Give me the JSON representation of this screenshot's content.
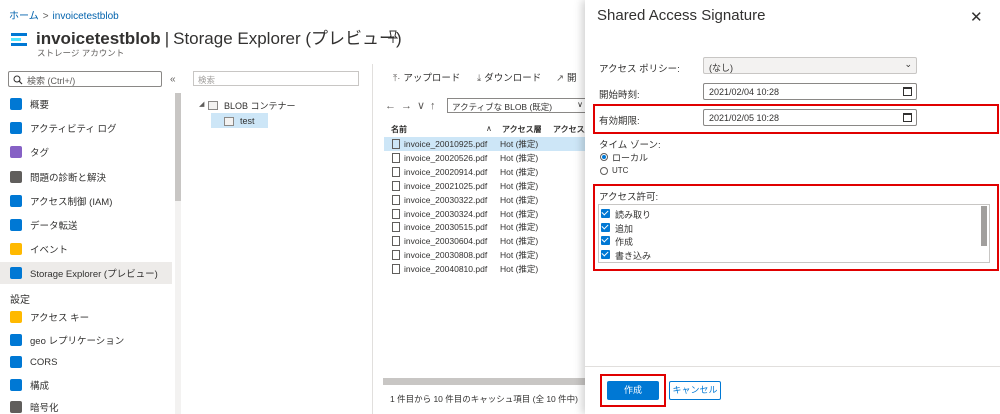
{
  "breadcrumb": {
    "home": "ホーム",
    "separator": ">",
    "current": "invoicetestblob"
  },
  "resource": {
    "name": "invoicetestblob",
    "section": "Storage Explorer (プレビュー)",
    "subtitle": "ストレージ アカウント"
  },
  "nav": {
    "search_placeholder": "検索 (Ctrl+/)",
    "collapse_glyph": "«",
    "items": [
      {
        "label": "概要",
        "icon": "overview-icon",
        "color": "#0078d4"
      },
      {
        "label": "アクティビティ ログ",
        "icon": "activity-log-icon",
        "color": "#0078d4"
      },
      {
        "label": "タグ",
        "icon": "tag-icon",
        "color": "#8661c5"
      },
      {
        "label": "問題の診断と解決",
        "icon": "wrench-icon",
        "color": "#605e5c"
      },
      {
        "label": "アクセス制御 (IAM)",
        "icon": "iam-icon",
        "color": "#0078d4"
      },
      {
        "label": "データ転送",
        "icon": "data-transfer-icon",
        "color": "#0078d4"
      },
      {
        "label": "イベント",
        "icon": "lightning-icon",
        "color": "#ffb900"
      },
      {
        "label": "Storage Explorer (プレビュー)",
        "icon": "storage-explorer-icon",
        "color": "#0078d4"
      }
    ],
    "settings_header": "設定",
    "settings_items": [
      {
        "label": "アクセス キー",
        "icon": "key-icon",
        "color": "#ffb900"
      },
      {
        "label": "geo レプリケーション",
        "icon": "globe-icon",
        "color": "#0078d4"
      },
      {
        "label": "CORS",
        "icon": "cors-icon",
        "color": "#0078d4"
      },
      {
        "label": "構成",
        "icon": "config-icon",
        "color": "#0078d4"
      },
      {
        "label": "暗号化",
        "icon": "lock-icon",
        "color": "#605e5c"
      }
    ]
  },
  "explorer": {
    "search_placeholder": "検索",
    "tree": {
      "root": "BLOB コンテナー",
      "child": "test"
    },
    "toolbar": {
      "upload": "アップロード",
      "download": "ダウンロード",
      "open": "開"
    },
    "nav_arrows": "←→∨↑",
    "path_value": "アクティブな BLOB (既定)",
    "columns": {
      "name": "名前",
      "access_tier": "アクセス層",
      "access_tier2": "アクセス層"
    },
    "files": [
      {
        "name": "invoice_20010925.pdf",
        "tier": "Hot (推定)"
      },
      {
        "name": "invoice_20020526.pdf",
        "tier": "Hot (推定)"
      },
      {
        "name": "invoice_20020914.pdf",
        "tier": "Hot (推定)"
      },
      {
        "name": "invoice_20021025.pdf",
        "tier": "Hot (推定)"
      },
      {
        "name": "invoice_20030322.pdf",
        "tier": "Hot (推定)"
      },
      {
        "name": "invoice_20030324.pdf",
        "tier": "Hot (推定)"
      },
      {
        "name": "invoice_20030515.pdf",
        "tier": "Hot (推定)"
      },
      {
        "name": "invoice_20030604.pdf",
        "tier": "Hot (推定)"
      },
      {
        "name": "invoice_20030808.pdf",
        "tier": "Hot (推定)"
      },
      {
        "name": "invoice_20040810.pdf",
        "tier": "Hot (推定)"
      }
    ],
    "status": "1 件目から 10 件目のキャッシュ項目 (全 10 件中)"
  },
  "sas": {
    "title": "Shared Access Signature",
    "close_glyph": "✕",
    "policy_label": "アクセス ポリシー:",
    "policy_value": "(なし)",
    "start_label": "開始時刻:",
    "start_value": "2021/02/04 10:28",
    "expiry_label": "有効期限:",
    "expiry_value": "2021/02/05 10:28",
    "timezone_label": "タイム ゾーン:",
    "timezone_local": "ローカル",
    "timezone_utc": "UTC",
    "permissions_label": "アクセス許可:",
    "permissions": [
      "読み取り",
      "追加",
      "作成",
      "書き込み"
    ],
    "create_button": "作成",
    "cancel_button": "キャンセル"
  },
  "colors": {
    "accent": "#0078d4",
    "highlight": "#e00000",
    "selection": "#cde6f7"
  }
}
